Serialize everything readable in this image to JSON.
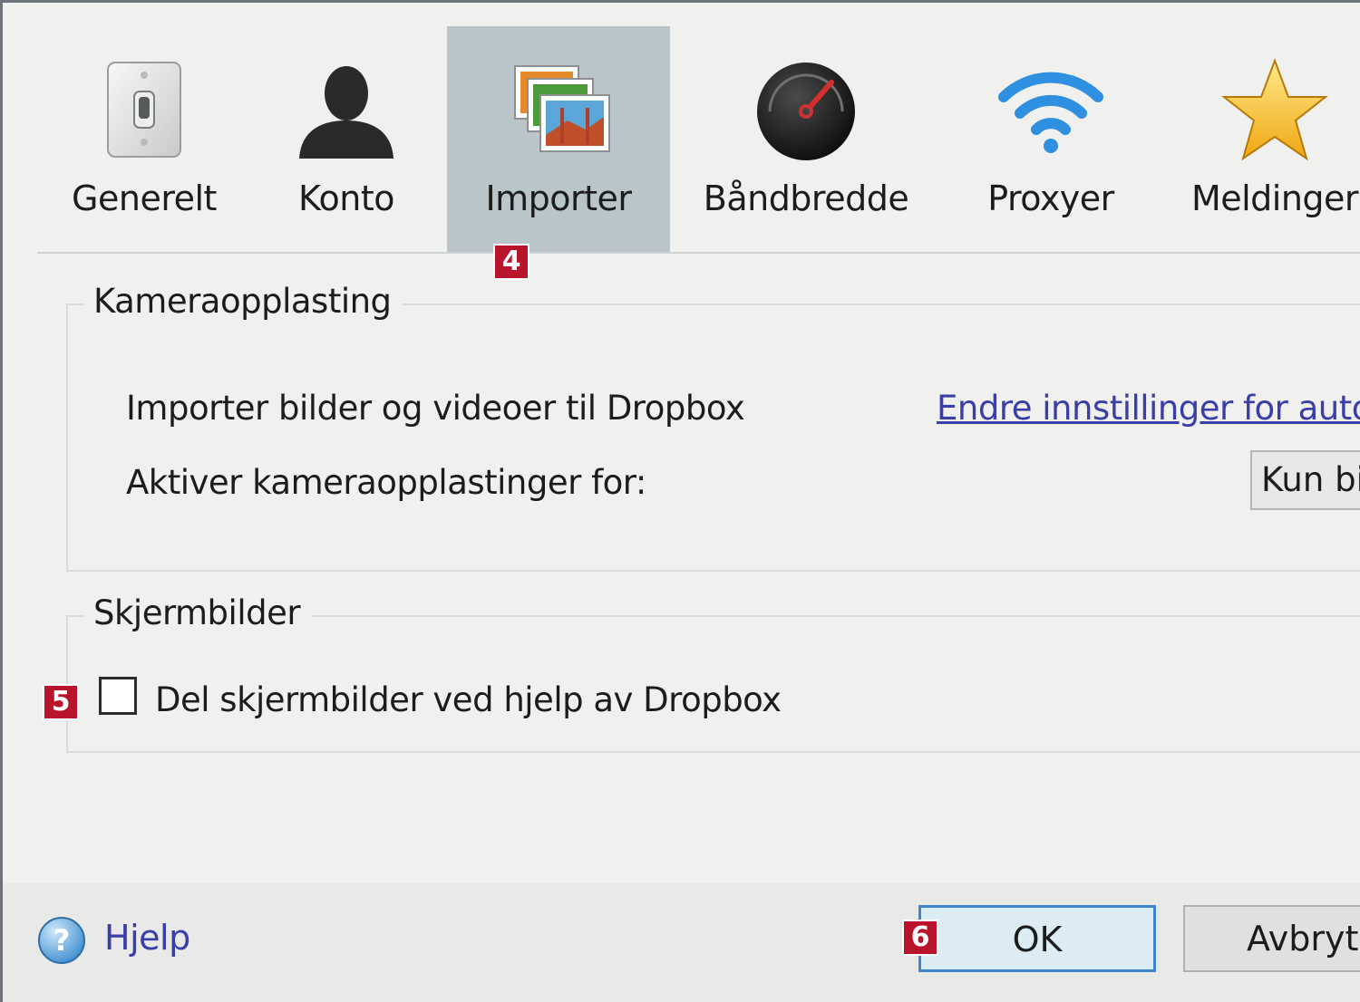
{
  "tabs": [
    {
      "label": "Generelt",
      "icon": "toggle-switch-icon"
    },
    {
      "label": "Konto",
      "icon": "user-icon"
    },
    {
      "label": "Importer",
      "icon": "photos-icon",
      "active": true
    },
    {
      "label": "Båndbredde",
      "icon": "speedometer-icon"
    },
    {
      "label": "Proxyer",
      "icon": "wifi-icon"
    },
    {
      "label": "Meldinger",
      "icon": "star-icon"
    }
  ],
  "badges": {
    "tab": "4",
    "checkbox": "5",
    "ok": "6"
  },
  "camera_upload": {
    "title": "Kameraopplasting",
    "import_label": "Importer bilder og videoer til Dropbox",
    "settings_link": "Endre innstillinger for autom",
    "enable_label": "Aktiver kameraopplastinger for:",
    "enable_value": "Kun bil"
  },
  "screenshots": {
    "title": "Skjermbilder",
    "share_label": "Del skjermbilder ved hjelp av Dropbox",
    "share_checked": false
  },
  "footer": {
    "help_label": "Hjelp",
    "ok_label": "OK",
    "cancel_label": "Avbryt"
  },
  "colors": {
    "active_tab": "#b9c5c8",
    "badge": "#b8142b",
    "link": "#3a3ea8",
    "ok_border": "#3e86c9"
  }
}
